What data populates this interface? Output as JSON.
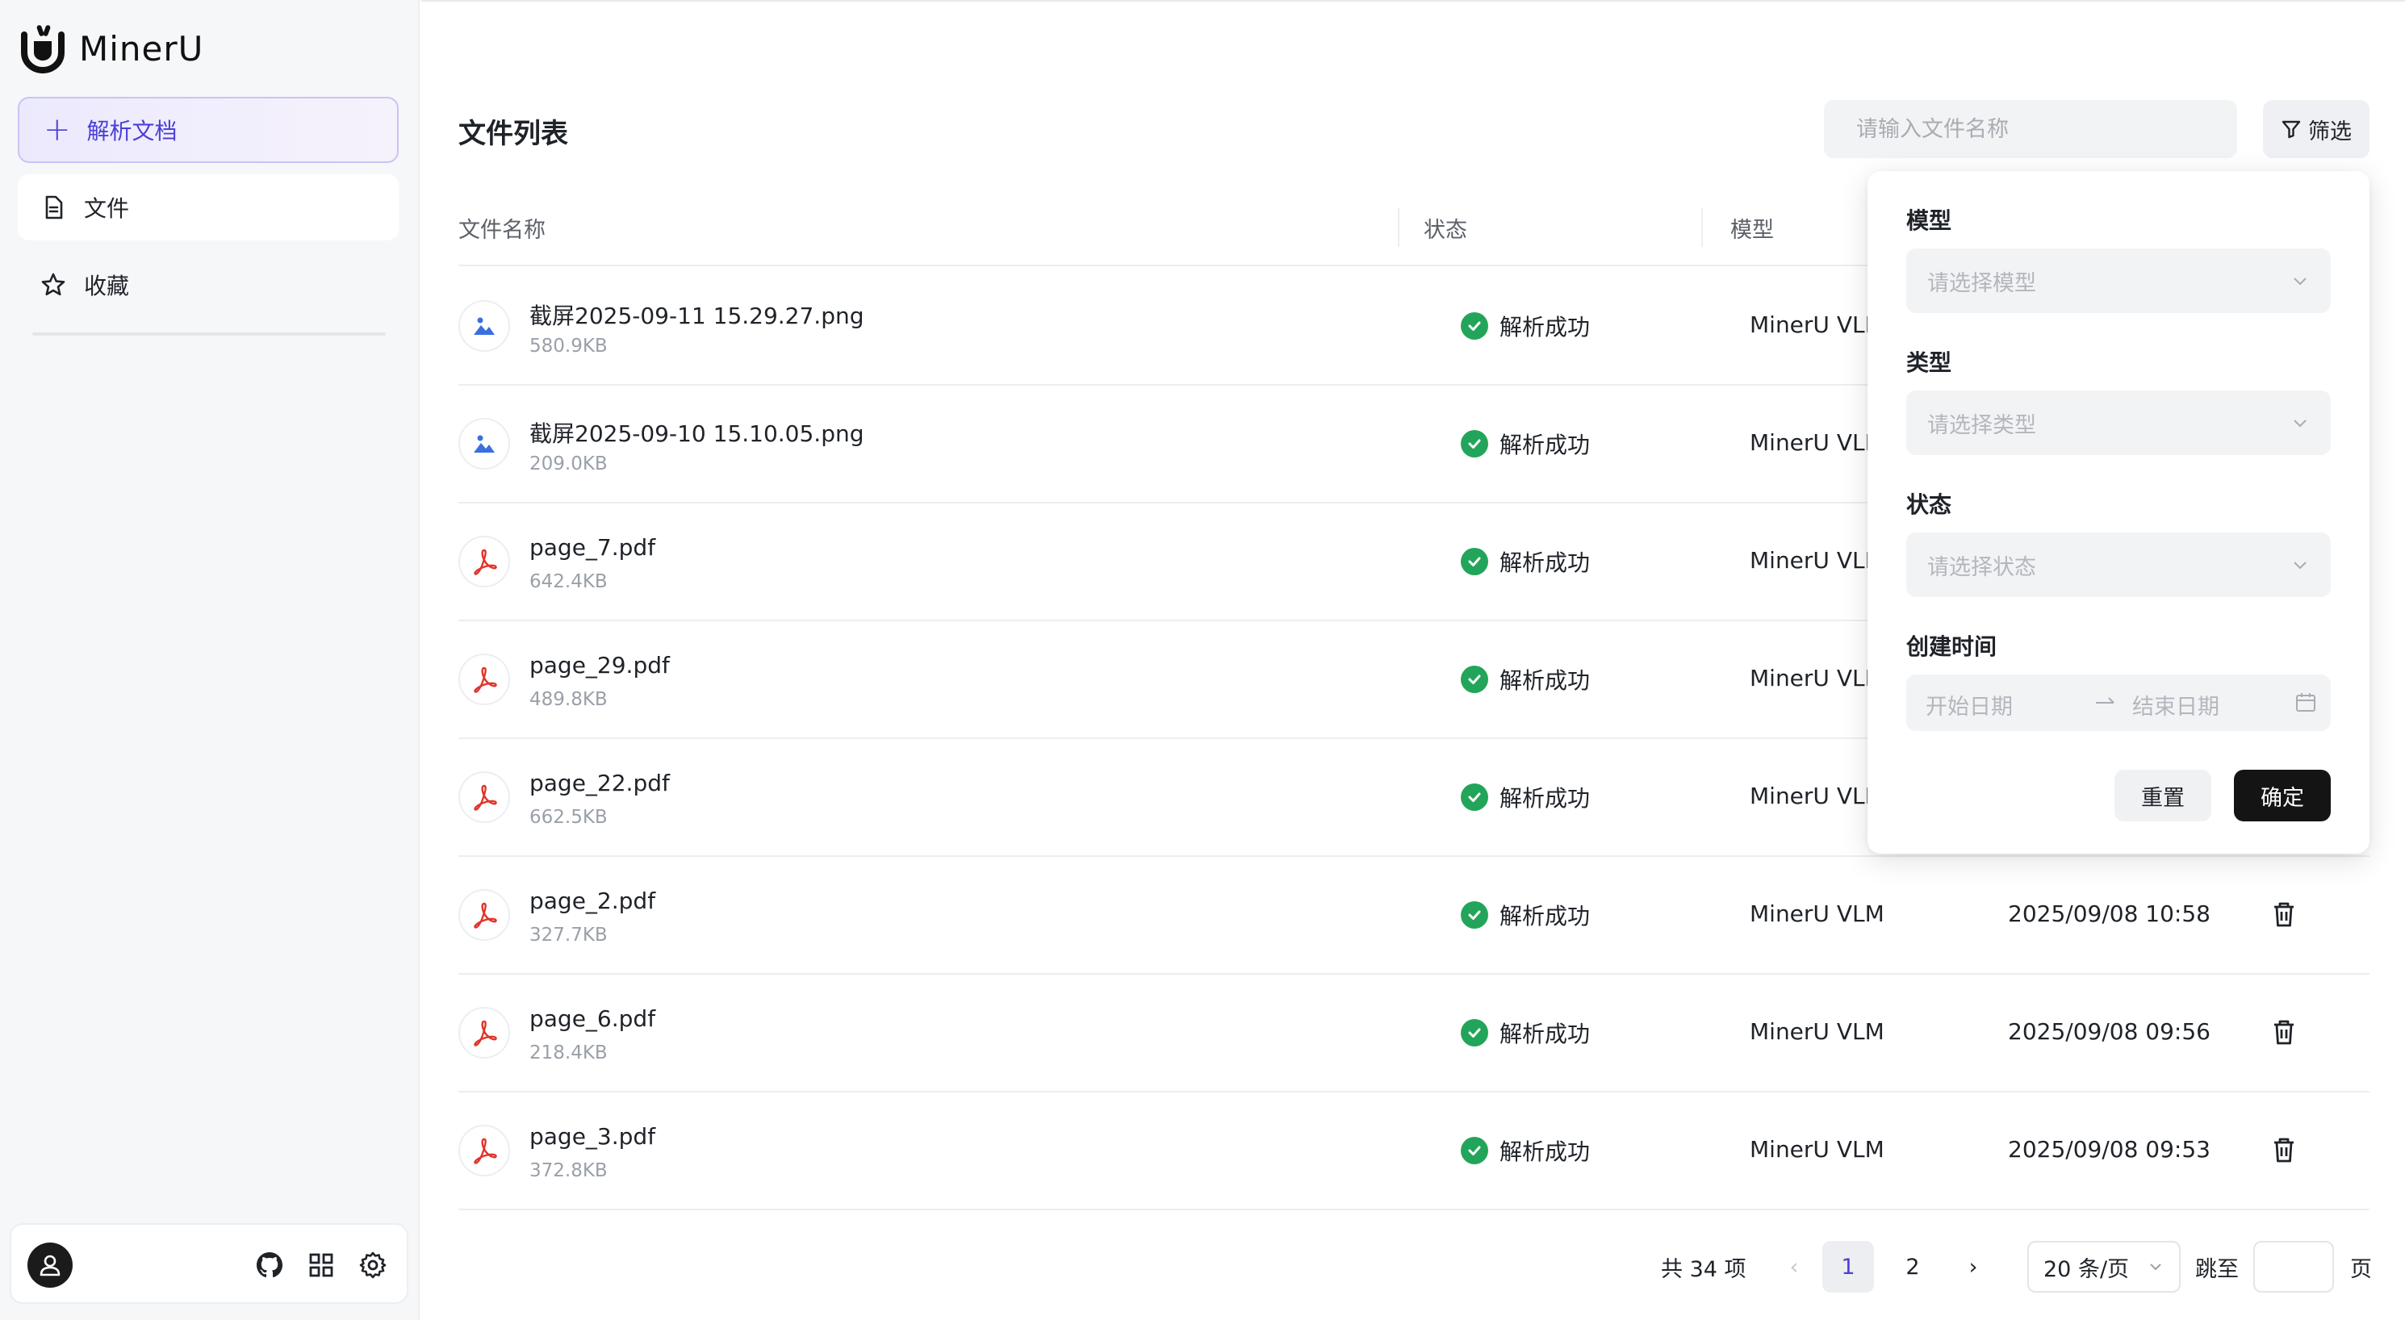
{
  "app": {
    "name": "MinerU"
  },
  "sidebar": {
    "new_parse_label": "解析文档",
    "items": [
      {
        "label": "文件",
        "icon": "file-icon",
        "active": true
      },
      {
        "label": "收藏",
        "icon": "star-icon",
        "active": false
      }
    ],
    "bottom_icons": [
      "user-avatar-icon",
      "github-icon",
      "apps-grid-icon",
      "settings-gear-icon"
    ]
  },
  "main": {
    "title": "文件列表",
    "search": {
      "placeholder": "请输入文件名称",
      "value": ""
    },
    "filter_label": "筛选",
    "columns": [
      "文件名称",
      "状态",
      "模型"
    ],
    "rows": [
      {
        "name": "截屏2025-09-11 15.29.27.png",
        "size": "580.9KB",
        "type": "image",
        "status": "解析成功",
        "model": "MinerU VLM",
        "time": ""
      },
      {
        "name": "截屏2025-09-10 15.10.05.png",
        "size": "209.0KB",
        "type": "image",
        "status": "解析成功",
        "model": "MinerU VLM",
        "time": ""
      },
      {
        "name": "page_7.pdf",
        "size": "642.4KB",
        "type": "pdf",
        "status": "解析成功",
        "model": "MinerU VLM",
        "time": ""
      },
      {
        "name": "page_29.pdf",
        "size": "489.8KB",
        "type": "pdf",
        "status": "解析成功",
        "model": "MinerU VLM",
        "time": ""
      },
      {
        "name": "page_22.pdf",
        "size": "662.5KB",
        "type": "pdf",
        "status": "解析成功",
        "model": "MinerU VLM",
        "time": ""
      },
      {
        "name": "page_2.pdf",
        "size": "327.7KB",
        "type": "pdf",
        "status": "解析成功",
        "model": "MinerU VLM",
        "time": "2025/09/08 10:58"
      },
      {
        "name": "page_6.pdf",
        "size": "218.4KB",
        "type": "pdf",
        "status": "解析成功",
        "model": "MinerU VLM",
        "time": "2025/09/08 09:56"
      },
      {
        "name": "page_3.pdf",
        "size": "372.8KB",
        "type": "pdf",
        "status": "解析成功",
        "model": "MinerU VLM",
        "time": "2025/09/08 09:53"
      }
    ],
    "pagination": {
      "total": "共 34 项",
      "pages": [
        "1",
        "2"
      ],
      "current": "1",
      "page_size": "20 条/页",
      "jump_label": "跳至",
      "page_suffix": "页"
    }
  },
  "filter_popover": {
    "model_label": "模型",
    "model_placeholder": "请选择模型",
    "type_label": "类型",
    "type_placeholder": "请选择类型",
    "status_label": "状态",
    "status_placeholder": "请选择状态",
    "time_label": "创建时间",
    "start_placeholder": "开始日期",
    "end_placeholder": "结束日期",
    "reset_label": "重置",
    "confirm_label": "确定"
  },
  "colors": {
    "accent": "#4b3fd6",
    "success": "#22a55a",
    "pdf_red": "#e0352b",
    "image_blue": "#3b6fe0",
    "dark_button": "#141414"
  }
}
